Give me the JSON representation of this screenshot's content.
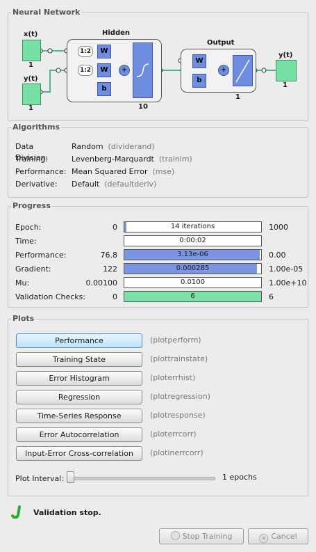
{
  "neural_network": {
    "title": "Neural Network",
    "input_labels": [
      "x(t)",
      "y(t)"
    ],
    "input_sizes": [
      "1",
      "1"
    ],
    "hidden_title": "Hidden",
    "hidden_size": "10",
    "output_title": "Output",
    "output_size": "1",
    "output_label": "y(t)",
    "output_io_size": "1",
    "delay_labels": [
      "1:2",
      "1:2"
    ],
    "weight_label": "W",
    "bias_label": "b",
    "sum_label": "+"
  },
  "algorithms": {
    "title": "Algorithms",
    "rows": [
      {
        "label": "Data Division:",
        "value": "Random",
        "cmd": "(dividerand)"
      },
      {
        "label": "Training:",
        "value": "Levenberg-Marquardt",
        "cmd": "(trainlm)"
      },
      {
        "label": "Performance:",
        "value": "Mean Squared Error",
        "cmd": "(mse)"
      },
      {
        "label": "Derivative:",
        "value": "Default",
        "cmd": "(defaultderiv)"
      }
    ]
  },
  "progress": {
    "title": "Progress",
    "rows": [
      {
        "label": "Epoch:",
        "start": "0",
        "value": "14 iterations",
        "end": "1000",
        "fill": 0.014,
        "color": "#7b95e3"
      },
      {
        "label": "Time:",
        "start": "",
        "value": "0:00:02",
        "end": "",
        "fill": 0,
        "color": "#7b95e3"
      },
      {
        "label": "Performance:",
        "start": "76.8",
        "value": "3.13e-06",
        "end": "0.00",
        "fill": 0.99,
        "color": "#7b95e3"
      },
      {
        "label": "Gradient:",
        "start": "122",
        "value": "0.000285",
        "end": "1.00e-05",
        "fill": 0.97,
        "color": "#7b95e3"
      },
      {
        "label": "Mu:",
        "start": "0.00100",
        "value": "0.0100",
        "end": "1.00e+10",
        "fill": 0,
        "color": "#7b95e3"
      },
      {
        "label": "Validation Checks:",
        "start": "0",
        "value": "6",
        "end": "6",
        "fill": 1.0,
        "color": "#79e0a6"
      }
    ]
  },
  "plots": {
    "title": "Plots",
    "buttons": [
      {
        "label": "Performance",
        "cmd": "(plotperform)"
      },
      {
        "label": "Training State",
        "cmd": "(plottrainstate)"
      },
      {
        "label": "Error Histogram",
        "cmd": "(ploterrhist)"
      },
      {
        "label": "Regression",
        "cmd": "(plotregression)"
      },
      {
        "label": "Time-Series Response",
        "cmd": "(plotresponse)"
      },
      {
        "label": "Error Autocorrelation",
        "cmd": "(ploterrcorr)"
      },
      {
        "label": "Input-Error Cross-correlation",
        "cmd": "(plotinerrcorr)"
      }
    ],
    "interval_label": "Plot Interval:",
    "interval_value": "1 epochs"
  },
  "status": {
    "text": "Validation stop.",
    "icon": "checkmark-icon",
    "icon_color": "#2eaa2e"
  },
  "footer": {
    "stop_label": "Stop Training",
    "cancel_label": "Cancel"
  }
}
